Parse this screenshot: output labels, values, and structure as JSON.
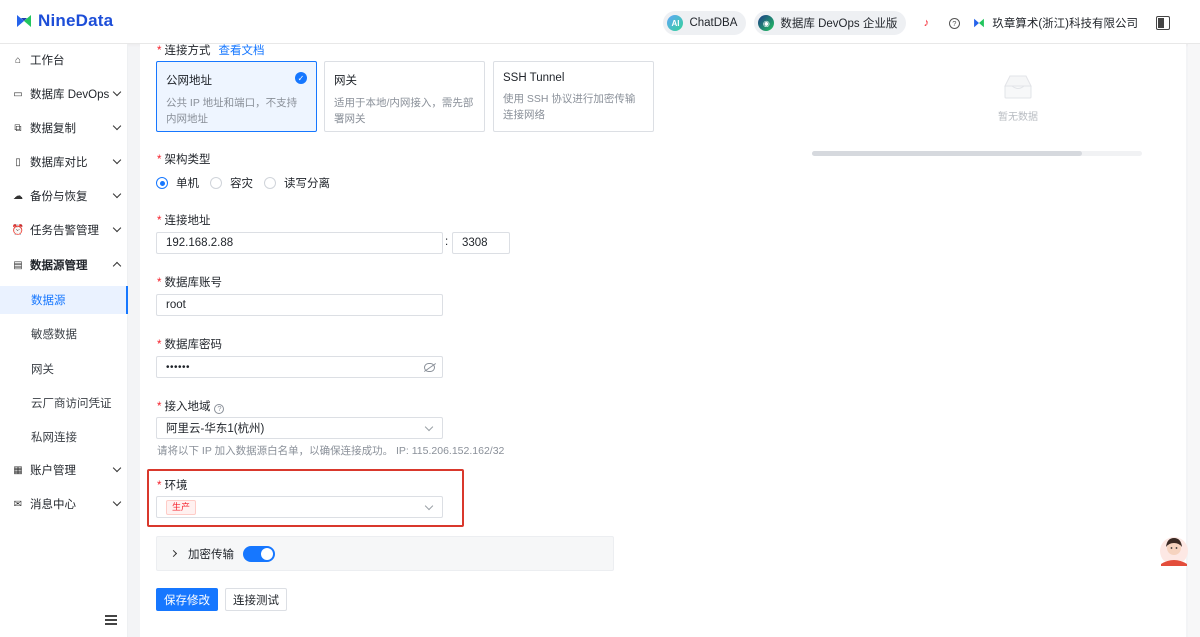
{
  "header": {
    "brand": "NineData",
    "chat_label": "ChatDBA",
    "chat_badge": "AI",
    "devops_label": "数据库 DevOps 企业版",
    "company": "玖章算术(浙江)科技有限公司"
  },
  "sidebar": {
    "items": [
      {
        "label": "工作台",
        "icon": "home-icon"
      },
      {
        "label": "数据库 DevOps",
        "icon": "monitor-icon"
      },
      {
        "label": "数据复制",
        "icon": "copy-icon"
      },
      {
        "label": "数据库对比",
        "icon": "compare-icon"
      },
      {
        "label": "备份与恢复",
        "icon": "cloud-icon"
      },
      {
        "label": "任务告警管理",
        "icon": "alarm-icon"
      },
      {
        "label": "数据源管理",
        "icon": "datasource-icon"
      },
      {
        "label": "账户管理",
        "icon": "account-icon"
      },
      {
        "label": "消息中心",
        "icon": "mail-icon"
      }
    ],
    "sub_items": [
      "数据源",
      "敏感数据",
      "网关",
      "云厂商访问凭证",
      "私网连接"
    ],
    "active_sub": "数据源"
  },
  "form": {
    "connection_method": {
      "label": "连接方式",
      "doc_link": "查看文档",
      "options": [
        {
          "title": "公网地址",
          "desc": "公共 IP 地址和端口，不支持内网地址",
          "selected": true
        },
        {
          "title": "网关",
          "desc": "适用于本地/内网接入，需先部署网关",
          "selected": false
        },
        {
          "title": "SSH Tunnel",
          "desc": "使用 SSH 协议进行加密传输连接网络",
          "selected": false
        }
      ]
    },
    "arch_type": {
      "label": "架构类型",
      "options": [
        "单机",
        "容灾",
        "读写分离"
      ],
      "selected": "单机"
    },
    "address": {
      "label": "连接地址",
      "host": "192.168.2.88",
      "separator": ":",
      "port": "3308"
    },
    "account": {
      "label": "数据库账号",
      "value": "root"
    },
    "password": {
      "label": "数据库密码",
      "masked": "••••••"
    },
    "region": {
      "label": "接入地域",
      "value": "阿里云-华东1(杭州)",
      "hint": "请将以下 IP 加入数据源白名单，以确保连接成功。 IP: 115.206.152.162/32"
    },
    "environment": {
      "label": "环境",
      "value": "生产"
    },
    "encryption": {
      "label": "加密传输",
      "enabled": true
    },
    "buttons": {
      "save": "保存修改",
      "test": "连接测试"
    }
  },
  "right_panel": {
    "empty_text": "暂无数据"
  },
  "colors": {
    "primary": "#1677ff",
    "required": "#f5222d",
    "highlight_border": "#d9382c"
  }
}
